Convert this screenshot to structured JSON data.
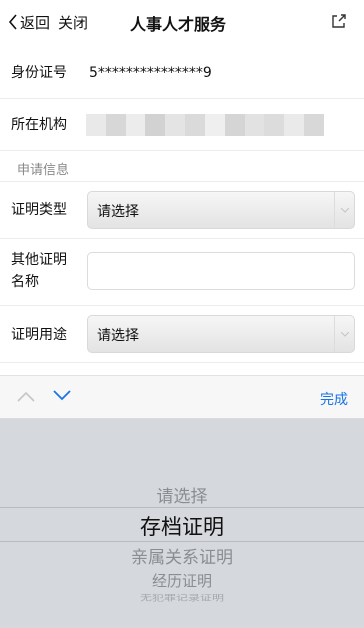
{
  "nav": {
    "back_label": "返回",
    "close_label": "关闭",
    "title": "人事人才服务"
  },
  "form": {
    "id_number": {
      "label": "身份证号",
      "value": "5***************9"
    },
    "institution": {
      "label": "所在机构"
    },
    "section_title": "申请信息",
    "cert_type": {
      "label": "证明类型",
      "value": "请选择"
    },
    "other_cert": {
      "label_line1": "其他证明",
      "label_line2": "名称",
      "value": ""
    },
    "cert_purpose": {
      "label": "证明用途",
      "value": "请选择"
    }
  },
  "accessory": {
    "done_label": "完成"
  },
  "picker": {
    "options": [
      "请选择",
      "存档证明",
      "亲属关系证明",
      "经历证明",
      "无犯罪记录证明"
    ],
    "selected_index": 1
  },
  "colors": {
    "accent": "#1a73e8",
    "picker_bg": "#d5d8dc",
    "accessory_bg": "#f7f7f7"
  }
}
